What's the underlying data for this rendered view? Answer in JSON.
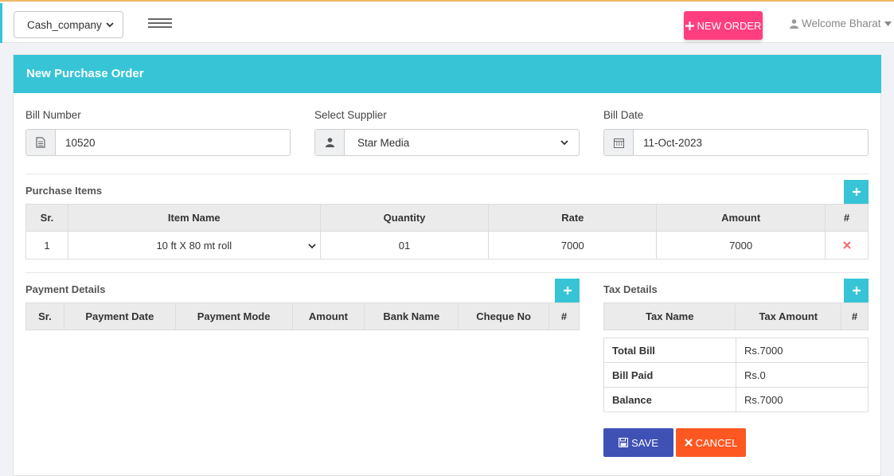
{
  "topbar": {
    "company": "Cash_company",
    "new_order_label": "NEW ORDER",
    "welcome_text": "Welcome Bharat"
  },
  "card": {
    "title": "New Purchase Order"
  },
  "form": {
    "bill_number_label": "Bill Number",
    "bill_number_value": "10520",
    "supplier_label": "Select Supplier",
    "supplier_value": "Star Media",
    "bill_date_label": "Bill Date",
    "bill_date_value": "11-Oct-2023"
  },
  "purchase_items": {
    "title": "Purchase Items",
    "headers": [
      "Sr.",
      "Item Name",
      "Quantity",
      "Rate",
      "Amount",
      "#"
    ],
    "rows": [
      {
        "sr": "1",
        "item": "10 ft X 80 mt roll",
        "quantity": "01",
        "rate": "7000",
        "amount": "7000"
      }
    ]
  },
  "payment_details": {
    "title": "Payment Details",
    "headers": [
      "Sr.",
      "Payment Date",
      "Payment Mode",
      "Amount",
      "Bank Name",
      "Cheque No",
      "#"
    ]
  },
  "tax_details": {
    "title": "Tax Details",
    "headers": [
      "Tax Name",
      "Tax Amount",
      "#"
    ]
  },
  "totals": {
    "total_bill_label": "Total Bill",
    "total_bill_value": "Rs.7000",
    "bill_paid_label": "Bill Paid",
    "bill_paid_value": "Rs.0",
    "balance_label": "Balance",
    "balance_value": "Rs.7000"
  },
  "actions": {
    "save_label": "SAVE",
    "cancel_label": "CANCEL"
  },
  "colors": {
    "accent": "#36c4d6",
    "new_order": "#ff3e80",
    "save": "#3f51b5",
    "cancel": "#ff5722",
    "delete": "#f07070"
  },
  "icons": {
    "bill_number": "file-icon",
    "supplier": "user-icon",
    "bill_date": "calendar-icon",
    "save": "floppy-icon",
    "cancel": "close-icon",
    "delete": "close-icon"
  }
}
